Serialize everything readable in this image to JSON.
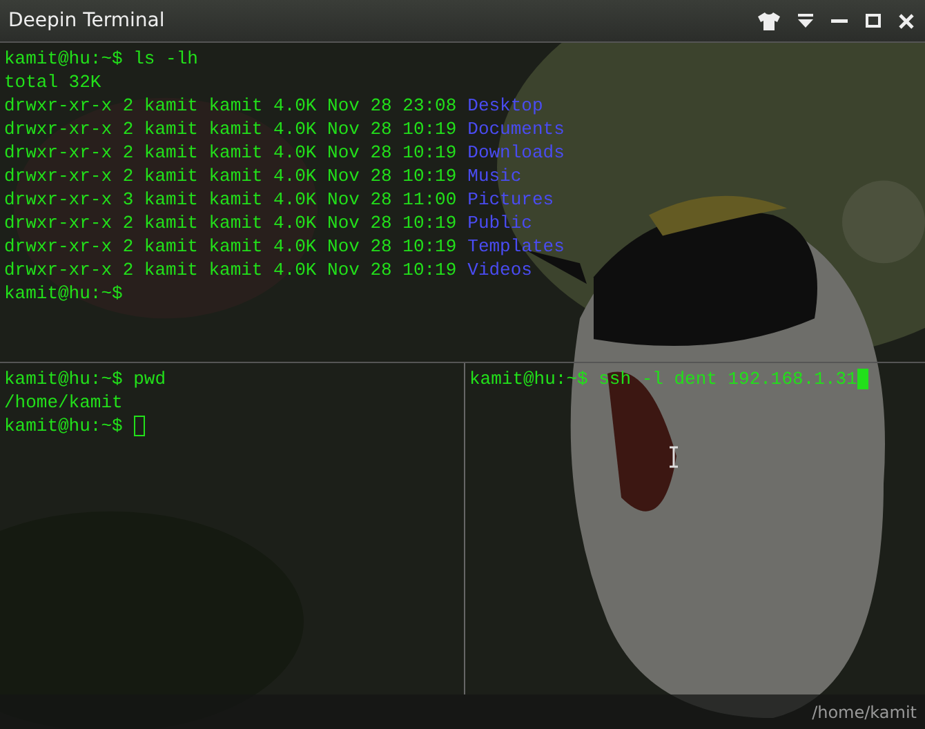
{
  "window": {
    "title": "Deepin Terminal"
  },
  "top_pane": {
    "lines": [
      {
        "kind": "prompt",
        "prompt": "kamit@hu:~$",
        "command": "ls -lh"
      },
      {
        "kind": "output",
        "text": "total 32K"
      },
      {
        "kind": "listing",
        "info": "drwxr-xr-x 2 kamit kamit 4.0K Nov 28 23:08",
        "name": "Desktop"
      },
      {
        "kind": "listing",
        "info": "drwxr-xr-x 2 kamit kamit 4.0K Nov 28 10:19",
        "name": "Documents"
      },
      {
        "kind": "listing",
        "info": "drwxr-xr-x 2 kamit kamit 4.0K Nov 28 10:19",
        "name": "Downloads"
      },
      {
        "kind": "listing",
        "info": "drwxr-xr-x 2 kamit kamit 4.0K Nov 28 10:19",
        "name": "Music"
      },
      {
        "kind": "listing",
        "info": "drwxr-xr-x 3 kamit kamit 4.0K Nov 28 11:00",
        "name": "Pictures"
      },
      {
        "kind": "listing",
        "info": "drwxr-xr-x 2 kamit kamit 4.0K Nov 28 10:19",
        "name": "Public"
      },
      {
        "kind": "listing",
        "info": "drwxr-xr-x 2 kamit kamit 4.0K Nov 28 10:19",
        "name": "Templates"
      },
      {
        "kind": "listing",
        "info": "drwxr-xr-x 2 kamit kamit 4.0K Nov 28 10:19",
        "name": "Videos"
      },
      {
        "kind": "prompt",
        "prompt": "kamit@hu:~$"
      }
    ]
  },
  "bottom_panes": [
    {
      "focused": false,
      "lines": [
        {
          "kind": "prompt",
          "prompt": "kamit@hu:~$",
          "command": "pwd"
        },
        {
          "kind": "output",
          "text": "/home/kamit"
        },
        {
          "kind": "prompt",
          "prompt": "kamit@hu:~$",
          "cursor": true
        }
      ]
    },
    {
      "focused": true,
      "lines": [
        {
          "kind": "prompt",
          "prompt": "kamit@hu:~$",
          "command": "ssh -l dent 192.168.1.31",
          "cursor": true
        }
      ]
    }
  ],
  "status_bar": {
    "path": "/home/kamit"
  }
}
